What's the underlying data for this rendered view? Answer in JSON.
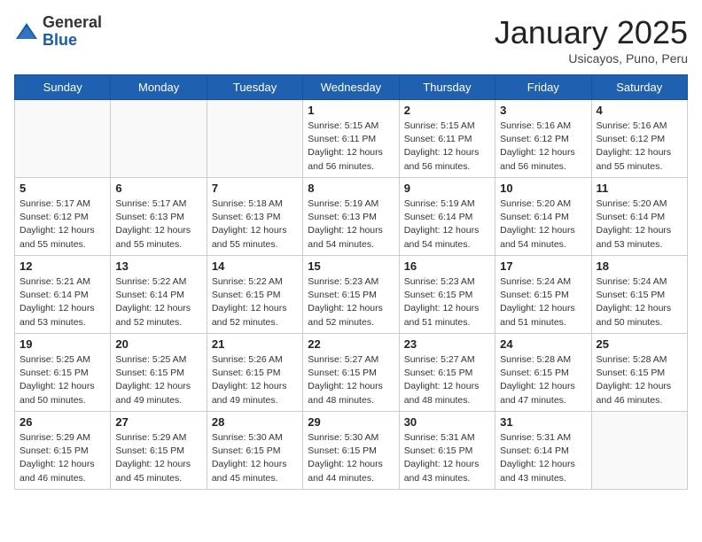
{
  "logo": {
    "general": "General",
    "blue": "Blue"
  },
  "header": {
    "month": "January 2025",
    "location": "Usicayos, Puno, Peru"
  },
  "weekdays": [
    "Sunday",
    "Monday",
    "Tuesday",
    "Wednesday",
    "Thursday",
    "Friday",
    "Saturday"
  ],
  "weeks": [
    [
      {
        "day": "",
        "info": ""
      },
      {
        "day": "",
        "info": ""
      },
      {
        "day": "",
        "info": ""
      },
      {
        "day": "1",
        "info": "Sunrise: 5:15 AM\nSunset: 6:11 PM\nDaylight: 12 hours\nand 56 minutes."
      },
      {
        "day": "2",
        "info": "Sunrise: 5:15 AM\nSunset: 6:11 PM\nDaylight: 12 hours\nand 56 minutes."
      },
      {
        "day": "3",
        "info": "Sunrise: 5:16 AM\nSunset: 6:12 PM\nDaylight: 12 hours\nand 56 minutes."
      },
      {
        "day": "4",
        "info": "Sunrise: 5:16 AM\nSunset: 6:12 PM\nDaylight: 12 hours\nand 55 minutes."
      }
    ],
    [
      {
        "day": "5",
        "info": "Sunrise: 5:17 AM\nSunset: 6:12 PM\nDaylight: 12 hours\nand 55 minutes."
      },
      {
        "day": "6",
        "info": "Sunrise: 5:17 AM\nSunset: 6:13 PM\nDaylight: 12 hours\nand 55 minutes."
      },
      {
        "day": "7",
        "info": "Sunrise: 5:18 AM\nSunset: 6:13 PM\nDaylight: 12 hours\nand 55 minutes."
      },
      {
        "day": "8",
        "info": "Sunrise: 5:19 AM\nSunset: 6:13 PM\nDaylight: 12 hours\nand 54 minutes."
      },
      {
        "day": "9",
        "info": "Sunrise: 5:19 AM\nSunset: 6:14 PM\nDaylight: 12 hours\nand 54 minutes."
      },
      {
        "day": "10",
        "info": "Sunrise: 5:20 AM\nSunset: 6:14 PM\nDaylight: 12 hours\nand 54 minutes."
      },
      {
        "day": "11",
        "info": "Sunrise: 5:20 AM\nSunset: 6:14 PM\nDaylight: 12 hours\nand 53 minutes."
      }
    ],
    [
      {
        "day": "12",
        "info": "Sunrise: 5:21 AM\nSunset: 6:14 PM\nDaylight: 12 hours\nand 53 minutes."
      },
      {
        "day": "13",
        "info": "Sunrise: 5:22 AM\nSunset: 6:14 PM\nDaylight: 12 hours\nand 52 minutes."
      },
      {
        "day": "14",
        "info": "Sunrise: 5:22 AM\nSunset: 6:15 PM\nDaylight: 12 hours\nand 52 minutes."
      },
      {
        "day": "15",
        "info": "Sunrise: 5:23 AM\nSunset: 6:15 PM\nDaylight: 12 hours\nand 52 minutes."
      },
      {
        "day": "16",
        "info": "Sunrise: 5:23 AM\nSunset: 6:15 PM\nDaylight: 12 hours\nand 51 minutes."
      },
      {
        "day": "17",
        "info": "Sunrise: 5:24 AM\nSunset: 6:15 PM\nDaylight: 12 hours\nand 51 minutes."
      },
      {
        "day": "18",
        "info": "Sunrise: 5:24 AM\nSunset: 6:15 PM\nDaylight: 12 hours\nand 50 minutes."
      }
    ],
    [
      {
        "day": "19",
        "info": "Sunrise: 5:25 AM\nSunset: 6:15 PM\nDaylight: 12 hours\nand 50 minutes."
      },
      {
        "day": "20",
        "info": "Sunrise: 5:25 AM\nSunset: 6:15 PM\nDaylight: 12 hours\nand 49 minutes."
      },
      {
        "day": "21",
        "info": "Sunrise: 5:26 AM\nSunset: 6:15 PM\nDaylight: 12 hours\nand 49 minutes."
      },
      {
        "day": "22",
        "info": "Sunrise: 5:27 AM\nSunset: 6:15 PM\nDaylight: 12 hours\nand 48 minutes."
      },
      {
        "day": "23",
        "info": "Sunrise: 5:27 AM\nSunset: 6:15 PM\nDaylight: 12 hours\nand 48 minutes."
      },
      {
        "day": "24",
        "info": "Sunrise: 5:28 AM\nSunset: 6:15 PM\nDaylight: 12 hours\nand 47 minutes."
      },
      {
        "day": "25",
        "info": "Sunrise: 5:28 AM\nSunset: 6:15 PM\nDaylight: 12 hours\nand 46 minutes."
      }
    ],
    [
      {
        "day": "26",
        "info": "Sunrise: 5:29 AM\nSunset: 6:15 PM\nDaylight: 12 hours\nand 46 minutes."
      },
      {
        "day": "27",
        "info": "Sunrise: 5:29 AM\nSunset: 6:15 PM\nDaylight: 12 hours\nand 45 minutes."
      },
      {
        "day": "28",
        "info": "Sunrise: 5:30 AM\nSunset: 6:15 PM\nDaylight: 12 hours\nand 45 minutes."
      },
      {
        "day": "29",
        "info": "Sunrise: 5:30 AM\nSunset: 6:15 PM\nDaylight: 12 hours\nand 44 minutes."
      },
      {
        "day": "30",
        "info": "Sunrise: 5:31 AM\nSunset: 6:15 PM\nDaylight: 12 hours\nand 43 minutes."
      },
      {
        "day": "31",
        "info": "Sunrise: 5:31 AM\nSunset: 6:14 PM\nDaylight: 12 hours\nand 43 minutes."
      },
      {
        "day": "",
        "info": ""
      }
    ]
  ]
}
